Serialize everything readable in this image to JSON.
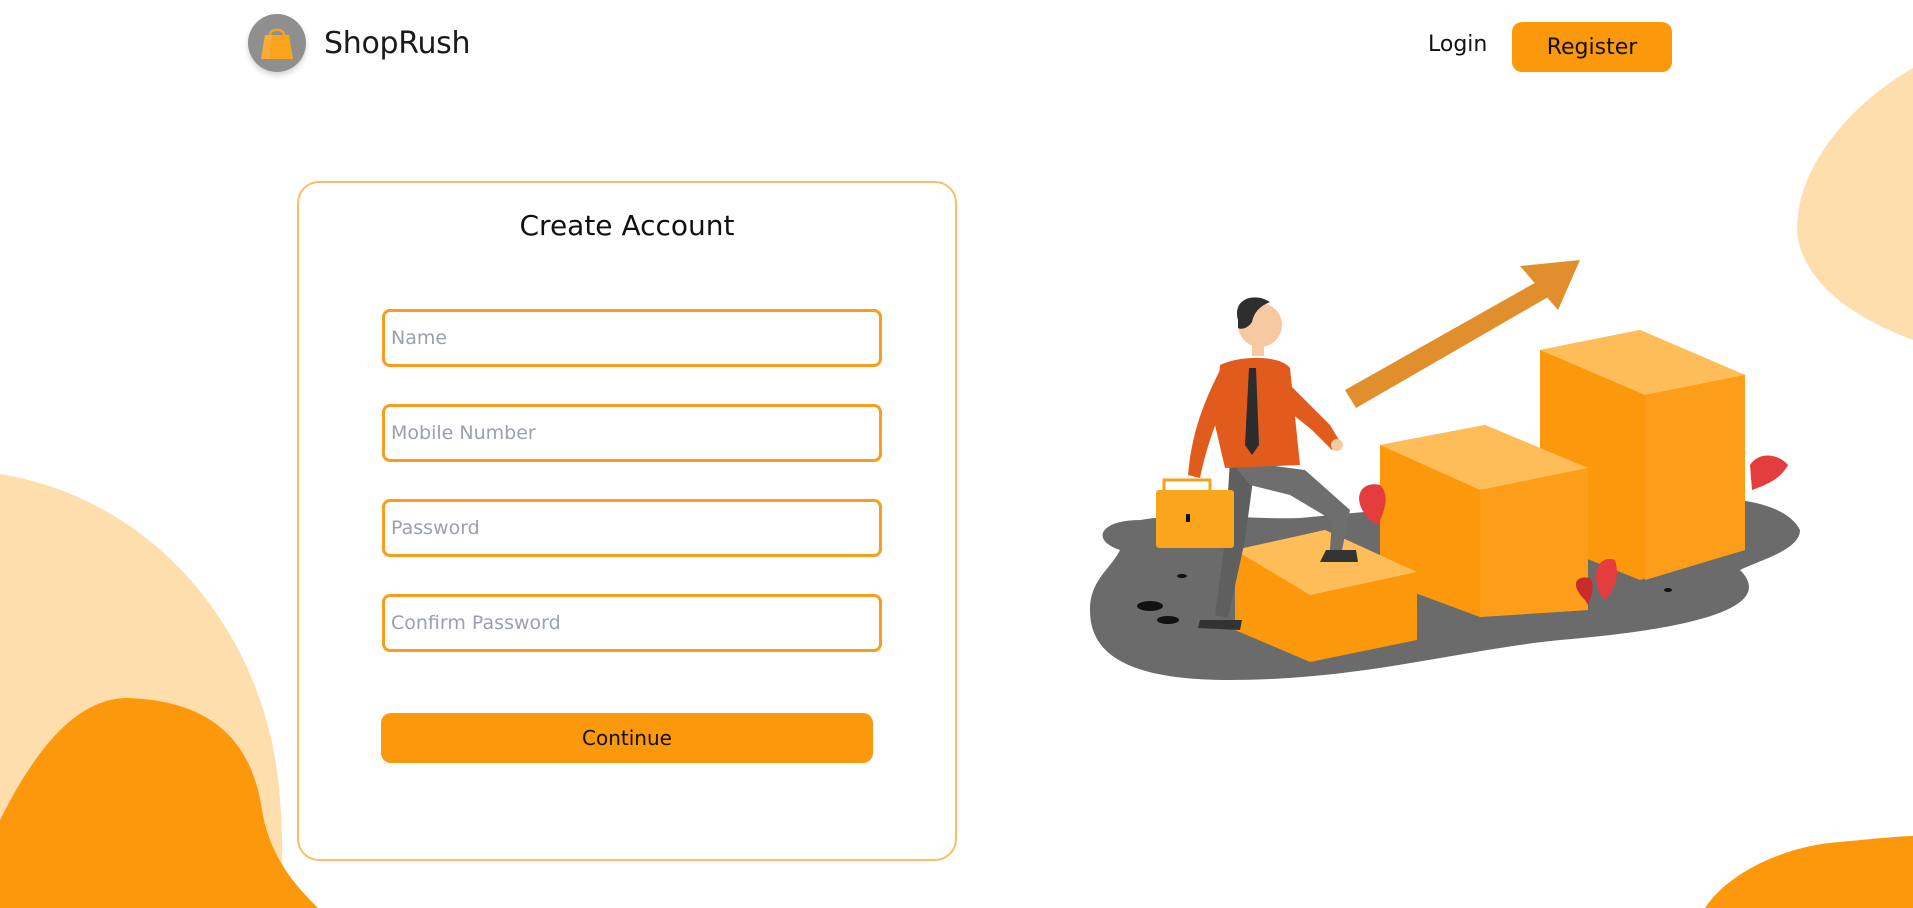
{
  "header": {
    "brand": "ShopRush",
    "login_label": "Login",
    "register_label": "Register"
  },
  "form": {
    "title": "Create Account",
    "fields": [
      {
        "placeholder": "Name",
        "value": ""
      },
      {
        "placeholder": "Mobile Number",
        "value": ""
      },
      {
        "placeholder": "Password",
        "value": ""
      },
      {
        "placeholder": "Confirm Password",
        "value": ""
      }
    ],
    "submit_label": "Continue"
  },
  "icons": {
    "logo": "shopping-bag-icon"
  },
  "colors": {
    "accent": "#fb980b",
    "field_border": "#f89d1e",
    "card_border": "#fdbd66",
    "blob_light": "#ffdeae",
    "blob_dark": "#fb980b",
    "logo_bg": "#8f8f8f"
  }
}
